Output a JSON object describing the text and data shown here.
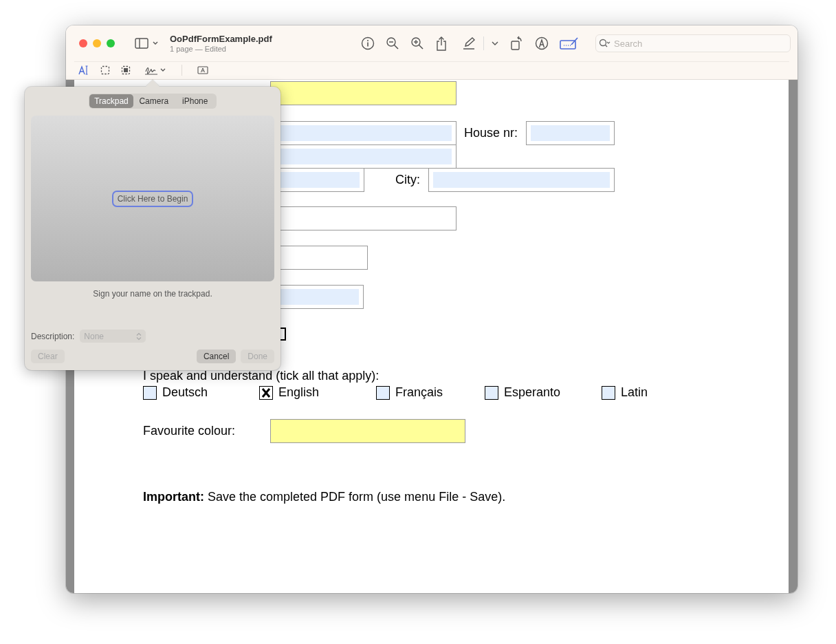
{
  "window": {
    "title": "OoPdfFormExample.pdf",
    "subtitle": "1 page — Edited"
  },
  "toolbar": {
    "search": {
      "placeholder": "Search"
    }
  },
  "form": {
    "rows": [
      [
        {
          "kind": "field",
          "color": "#ffff99"
        }
      ],
      [
        {
          "kind": "field",
          "color": "#e3eefd"
        },
        {
          "kind": "label",
          "text": "House nr:"
        },
        {
          "kind": "field",
          "color": "#e3eefd"
        }
      ],
      [
        {
          "kind": "field",
          "color": "#e3eefd"
        }
      ],
      [
        {
          "kind": "field",
          "color": "#e3eefd"
        },
        {
          "kind": "label",
          "text": "City:"
        },
        {
          "kind": "field",
          "color": "#e3eefd"
        }
      ],
      [
        {
          "kind": "field",
          "color": "#ffffff"
        }
      ],
      [
        {
          "kind": "field",
          "color": "#ffffff"
        }
      ],
      [
        {
          "kind": "field",
          "color": "#e3eefd"
        }
      ],
      [
        {
          "kind": "checkbox",
          "checked": false
        }
      ]
    ],
    "languages_label": "I speak and understand (tick all that apply):",
    "languages": [
      {
        "label": "Deutsch",
        "checked": false
      },
      {
        "label": "English",
        "checked": true
      },
      {
        "label": "Français",
        "checked": false
      },
      {
        "label": "Esperanto",
        "checked": false
      },
      {
        "label": "Latin",
        "checked": false
      }
    ],
    "colour_label": "Favourite colour:",
    "colour_field": {
      "color": "#ffff99"
    },
    "notice": "**Important:** Save the completed PDF form (use menu File - Save)."
  },
  "signature_popover": {
    "tabs": [
      {
        "label": "Trackpad",
        "selected": true
      },
      {
        "label": "Camera",
        "selected": false
      },
      {
        "label": "iPhone",
        "selected": false
      }
    ],
    "begin_button": "Click Here to Begin",
    "hint": "Sign your name on the trackpad.",
    "description_label": "Description:",
    "description_value": "None",
    "buttons": [
      {
        "label": "Clear",
        "disabled": true
      },
      {
        "label": "Cancel",
        "disabled": false
      },
      {
        "label": "Done",
        "disabled": true
      }
    ]
  }
}
